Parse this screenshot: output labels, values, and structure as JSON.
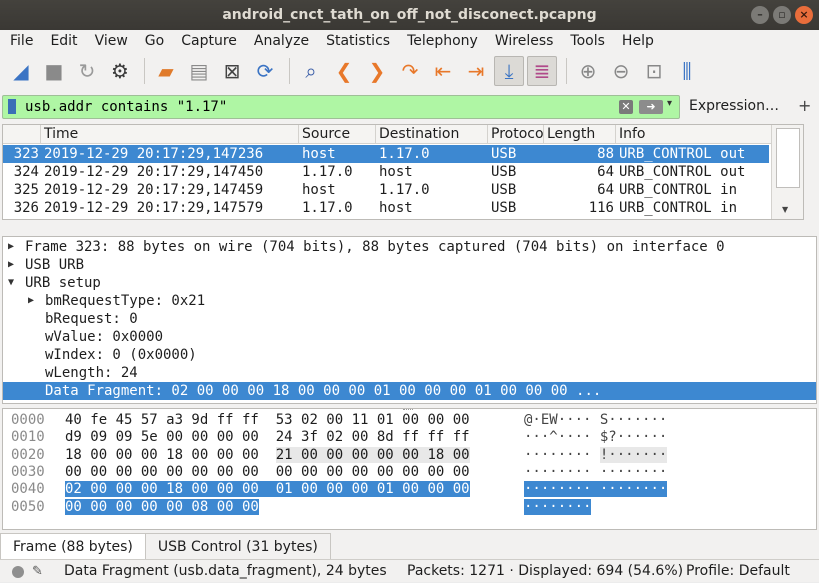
{
  "window": {
    "title": "android_cnct_tath_on_off_not_disconect.pcapng"
  },
  "menu": [
    "File",
    "Edit",
    "View",
    "Go",
    "Capture",
    "Analyze",
    "Statistics",
    "Telephony",
    "Wireless",
    "Tools",
    "Help"
  ],
  "toolbar_icons": [
    "shark-fin-start-icon",
    "stop-capture-icon",
    "restart-capture-icon",
    "capture-options-icon",
    "open-file-icon",
    "save-file-icon",
    "close-file-icon",
    "reload-file-icon",
    "find-packet-icon",
    "go-back-icon",
    "go-forward-icon",
    "go-to-packet-icon",
    "go-first-icon",
    "go-last-icon",
    "autoscroll-icon",
    "colorize-icon",
    "zoom-in-icon",
    "zoom-out-icon",
    "normal-size-icon",
    "resize-columns-icon"
  ],
  "filter": {
    "value": "usb.addr contains \"1.17\"",
    "expression_label": "Expression…",
    "plus_label": "+"
  },
  "packet_list": {
    "columns": [
      "",
      "Time",
      "Source",
      "Destination",
      "Protoco",
      "Length",
      "Info"
    ],
    "rows": [
      {
        "no": "323",
        "time": "2019-12-29 20:17:29,147236",
        "source": "host",
        "destination": "1.17.0",
        "protocol": "USB",
        "length": "88",
        "info": "URB_CONTROL out",
        "selected": true
      },
      {
        "no": "324",
        "time": "2019-12-29 20:17:29,147450",
        "source": "1.17.0",
        "destination": "host",
        "protocol": "USB",
        "length": "64",
        "info": "URB_CONTROL out",
        "selected": false
      },
      {
        "no": "325",
        "time": "2019-12-29 20:17:29,147459",
        "source": "host",
        "destination": "1.17.0",
        "protocol": "USB",
        "length": "64",
        "info": "URB_CONTROL in",
        "selected": false
      },
      {
        "no": "326",
        "time": "2019-12-29 20:17:29,147579",
        "source": "1.17.0",
        "destination": "host",
        "protocol": "USB",
        "length": "116",
        "info": "URB_CONTROL in",
        "selected": false
      }
    ]
  },
  "details": [
    {
      "indent": 0,
      "tri": "▶",
      "text": "Frame 323: 88 bytes on wire (704 bits), 88 bytes captured (704 bits) on interface 0",
      "selected": false
    },
    {
      "indent": 0,
      "tri": "▶",
      "text": "USB URB",
      "selected": false
    },
    {
      "indent": 0,
      "tri": "▼",
      "text": "URB setup",
      "selected": false
    },
    {
      "indent": 1,
      "tri": "▶",
      "text": "bmRequestType: 0x21",
      "selected": false
    },
    {
      "indent": 1,
      "tri": "",
      "text": "bRequest: 0",
      "selected": false
    },
    {
      "indent": 1,
      "tri": "",
      "text": "wValue: 0x0000",
      "selected": false
    },
    {
      "indent": 1,
      "tri": "",
      "text": "wIndex: 0 (0x0000)",
      "selected": false
    },
    {
      "indent": 1,
      "tri": "",
      "text": "wLength: 24",
      "selected": false
    },
    {
      "indent": 1,
      "tri": "",
      "text": "Data Fragment: 02 00 00 00 18 00 00 00 01 00 00 00 01 00 00 00 ...",
      "selected": true
    }
  ],
  "bytes": [
    {
      "offset": "0000",
      "hex_a": "40 fe 45 57 a3 9d ff ff",
      "hex_b": "53 02 00 11 01 00 00 00",
      "ascii_a": "@·EW····",
      "ascii_b": "S·······",
      "hl": "none"
    },
    {
      "offset": "0010",
      "hex_a": "d9 09 09 5e 00 00 00 00",
      "hex_b": "24 3f 02 00 8d ff ff ff",
      "ascii_a": "···^····",
      "ascii_b": "$?······",
      "hl": "none"
    },
    {
      "offset": "0020",
      "hex_a": "18 00 00 00 18 00 00 00",
      "hex_b": "21 00 00 00 00 00 18 00",
      "ascii_a": "········",
      "ascii_b": "!·······",
      "hl": "b-light"
    },
    {
      "offset": "0030",
      "hex_a": "00 00 00 00 00 00 00 00",
      "hex_b": "00 00 00 00 00 00 00 00",
      "ascii_a": "········",
      "ascii_b": "········",
      "hl": "none"
    },
    {
      "offset": "0040",
      "hex_a": "02 00 00 00 18 00 00 00",
      "hex_b": "01 00 00 00 01 00 00 00",
      "ascii_a": "········",
      "ascii_b": "········",
      "hl": "full"
    },
    {
      "offset": "0050",
      "hex_a": "00 00 00 00 00 08 00 00",
      "hex_b": "",
      "ascii_a": "········",
      "ascii_b": "",
      "hl": "a"
    }
  ],
  "byte_tabs": [
    {
      "label": "Frame (88 bytes)",
      "active": true
    },
    {
      "label": "USB Control (31 bytes)",
      "active": false
    }
  ],
  "status": {
    "field": "Data Fragment (usb.data_fragment), 24 bytes",
    "packets": "Packets: 1271 · Displayed: 694 (54.6%)",
    "profile": "Profile: Default"
  },
  "colors": {
    "selection": "#3d88d1",
    "filter_ok": "#aff6a4",
    "titlebar": "#3c3b37"
  }
}
